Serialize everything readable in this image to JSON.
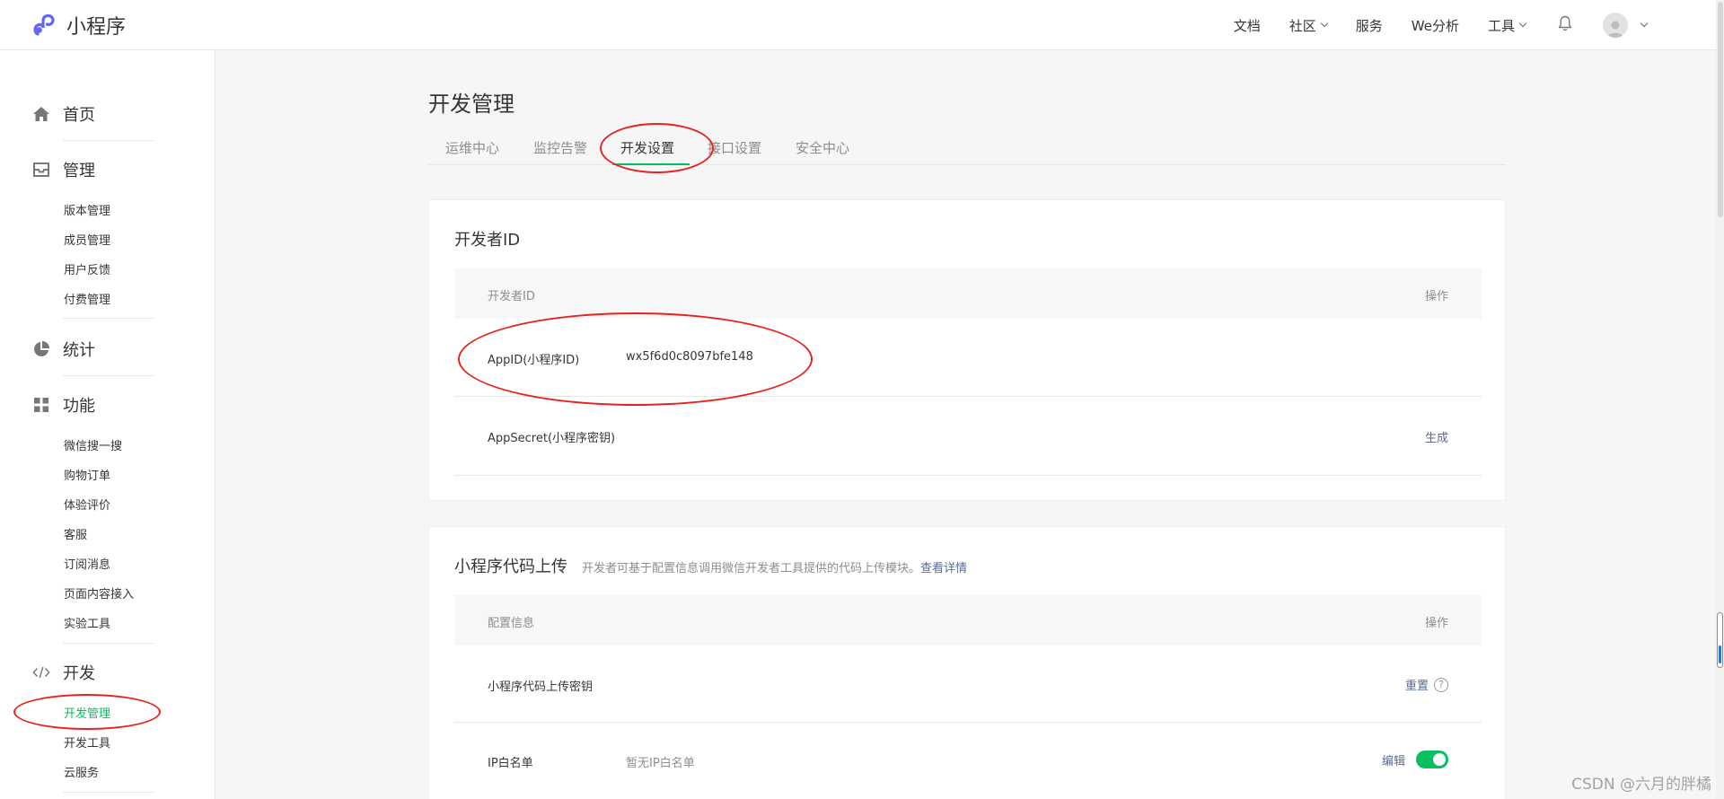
{
  "app": {
    "title": "小程序"
  },
  "topnav": {
    "items": [
      {
        "label": "文档",
        "dropdown": false
      },
      {
        "label": "社区",
        "dropdown": true
      },
      {
        "label": "服务",
        "dropdown": false
      },
      {
        "label": "We分析",
        "dropdown": false
      },
      {
        "label": "工具",
        "dropdown": true
      }
    ],
    "icons": [
      "bell-icon",
      "avatar-icon",
      "chevron-down-icon"
    ]
  },
  "sidebar": {
    "groups": [
      {
        "label": "首页",
        "icon": "home-icon",
        "items": []
      },
      {
        "label": "管理",
        "icon": "inbox-icon",
        "items": [
          "版本管理",
          "成员管理",
          "用户反馈",
          "付费管理"
        ]
      },
      {
        "label": "统计",
        "icon": "pie-chart-icon",
        "items": []
      },
      {
        "label": "功能",
        "icon": "grid-icon",
        "items": [
          "微信搜一搜",
          "购物订单",
          "体验评价",
          "客服",
          "订阅消息",
          "页面内容接入",
          "实验工具"
        ]
      },
      {
        "label": "开发",
        "icon": "code-icon",
        "items": [
          "开发管理",
          "开发工具",
          "云服务"
        ]
      }
    ],
    "active_item": "开发管理"
  },
  "main": {
    "page_title": "开发管理",
    "tabs": [
      "运维中心",
      "监控告警",
      "开发设置",
      "接口设置",
      "安全中心"
    ],
    "active_tab": "开发设置"
  },
  "developer_id": {
    "title": "开发者ID",
    "header": {
      "col1": "开发者ID",
      "col2": "操作"
    },
    "rows": [
      {
        "key": "AppID(小程序ID)",
        "value": "wx5f6d0c8097bfe148",
        "action": ""
      },
      {
        "key": "AppSecret(小程序密钥)",
        "value": "",
        "action": "生成"
      }
    ]
  },
  "code_upload": {
    "title": "小程序代码上传",
    "desc": "开发者可基于配置信息调用微信开发者工具提供的代码上传模块。",
    "desc_link": "查看详情",
    "header": {
      "col1": "配置信息",
      "col2": "操作"
    },
    "rows": [
      {
        "key": "小程序代码上传密钥",
        "value": "",
        "action": "重置",
        "help": "?"
      },
      {
        "key": "IP白名单",
        "value": "暂无IP白名单",
        "action": "编辑",
        "toggle": "on"
      }
    ]
  },
  "watermark": "CSDN @六月的胖橘",
  "colors": {
    "accent": "#07c160",
    "link": "#576b95",
    "annotation": "#e8221e"
  }
}
